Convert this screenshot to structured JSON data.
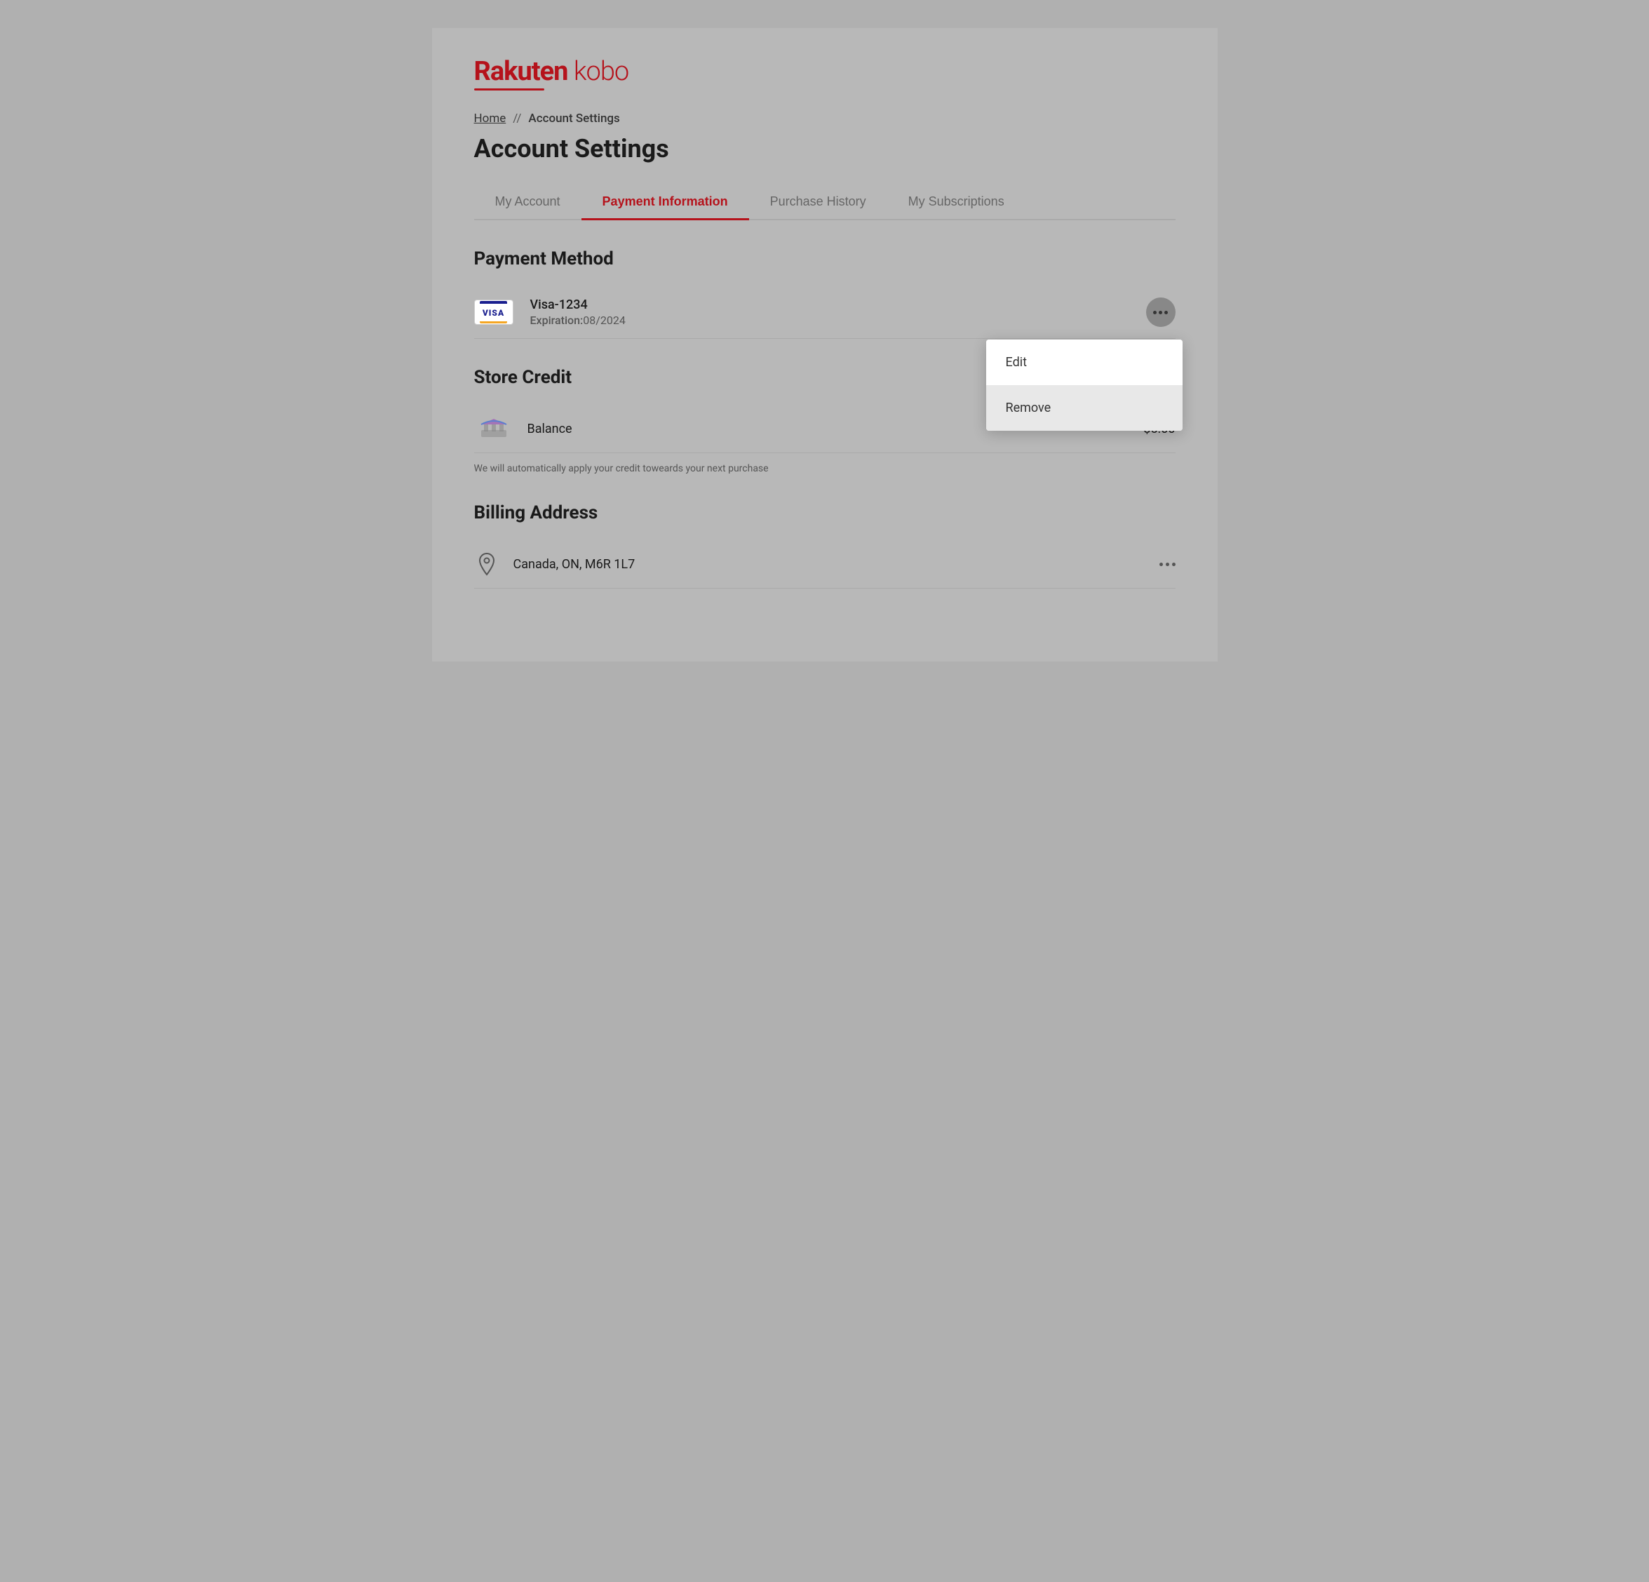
{
  "logo": {
    "text": "Rakuten kobo",
    "text_rakuten": "Rakuten",
    "text_kobo": "kobo"
  },
  "breadcrumb": {
    "home": "Home",
    "separator": "//",
    "current": "Account Settings"
  },
  "page_title": "Account Settings",
  "tabs": [
    {
      "id": "my-account",
      "label": "My Account",
      "active": false
    },
    {
      "id": "payment-information",
      "label": "Payment Information",
      "active": true
    },
    {
      "id": "purchase-history",
      "label": "Purchase History",
      "active": false
    },
    {
      "id": "my-subscriptions",
      "label": "My Subscriptions",
      "active": false
    }
  ],
  "payment_method": {
    "section_title": "Payment Method",
    "card": {
      "brand": "VISA",
      "name": "Visa-1234",
      "expiry_label": "Expiration:",
      "expiry_value": "08/2024"
    },
    "dropdown": {
      "edit_label": "Edit",
      "remove_label": "Remove"
    }
  },
  "store_credit": {
    "section_title": "Store Credit",
    "balance_label": "Balance",
    "balance_amount": "$5.00",
    "credit_note": "We will automatically apply your credit toweards your next purchase"
  },
  "billing_address": {
    "section_title": "Billing Address",
    "address": "Canada, ON, M6R 1L7"
  }
}
